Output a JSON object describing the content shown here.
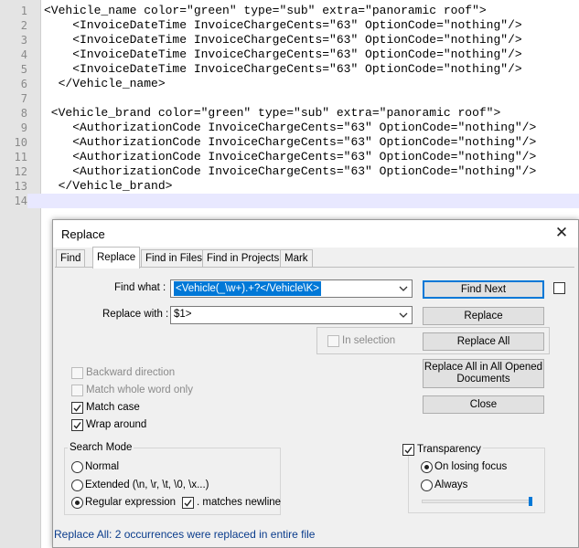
{
  "editor": {
    "lines": [
      {
        "num": "1",
        "text": "<Vehicle_name color=\"green\" type=\"sub\" extra=\"panoramic roof\">"
      },
      {
        "num": "2",
        "text": "    <InvoiceDateTime InvoiceChargeCents=\"63\" OptionCode=\"nothing\"/>"
      },
      {
        "num": "3",
        "text": "    <InvoiceDateTime InvoiceChargeCents=\"63\" OptionCode=\"nothing\"/>"
      },
      {
        "num": "4",
        "text": "    <InvoiceDateTime InvoiceChargeCents=\"63\" OptionCode=\"nothing\"/>"
      },
      {
        "num": "5",
        "text": "    <InvoiceDateTime InvoiceChargeCents=\"63\" OptionCode=\"nothing\"/>"
      },
      {
        "num": "6",
        "text": "  </Vehicle_name>"
      },
      {
        "num": "7",
        "text": ""
      },
      {
        "num": "8",
        "text": " <Vehicle_brand color=\"green\" type=\"sub\" extra=\"panoramic roof\">"
      },
      {
        "num": "9",
        "text": "    <AuthorizationCode InvoiceChargeCents=\"63\" OptionCode=\"nothing\"/>"
      },
      {
        "num": "10",
        "text": "    <AuthorizationCode InvoiceChargeCents=\"63\" OptionCode=\"nothing\"/>"
      },
      {
        "num": "11",
        "text": "    <AuthorizationCode InvoiceChargeCents=\"63\" OptionCode=\"nothing\"/>"
      },
      {
        "num": "12",
        "text": "    <AuthorizationCode InvoiceChargeCents=\"63\" OptionCode=\"nothing\"/>"
      },
      {
        "num": "13",
        "text": "  </Vehicle_brand>"
      },
      {
        "num": "14",
        "text": ""
      }
    ]
  },
  "dialog": {
    "title": "Replace",
    "tabs": [
      "Find",
      "Replace",
      "Find in Files",
      "Find in Projects",
      "Mark"
    ],
    "find_label": "Find what :",
    "find_value": "<Vehicle(_\\w+).+?</Vehicle\\K>",
    "replace_label": "Replace with :",
    "replace_value": "$1>",
    "in_selection": "In selection",
    "buttons": {
      "find_next": "Find Next",
      "replace": "Replace",
      "replace_all": "Replace All",
      "replace_all_opened_1": "Replace All in All Opened",
      "replace_all_opened_2": "Documents",
      "close": "Close"
    },
    "options": {
      "backward": "Backward direction",
      "whole_word": "Match whole word only",
      "match_case": "Match case",
      "wrap_around": "Wrap around"
    },
    "search_mode": {
      "title": "Search Mode",
      "normal": "Normal",
      "extended": "Extended (\\n, \\r, \\t, \\0, \\x...)",
      "regex": "Regular expression",
      "matches_newline": ". matches newline"
    },
    "transparency": {
      "title": "Transparency",
      "on_losing_focus": "On losing focus",
      "always": "Always",
      "slider_level": 1.0
    },
    "status": "Replace All: 2 occurrences were replaced in entire file"
  }
}
